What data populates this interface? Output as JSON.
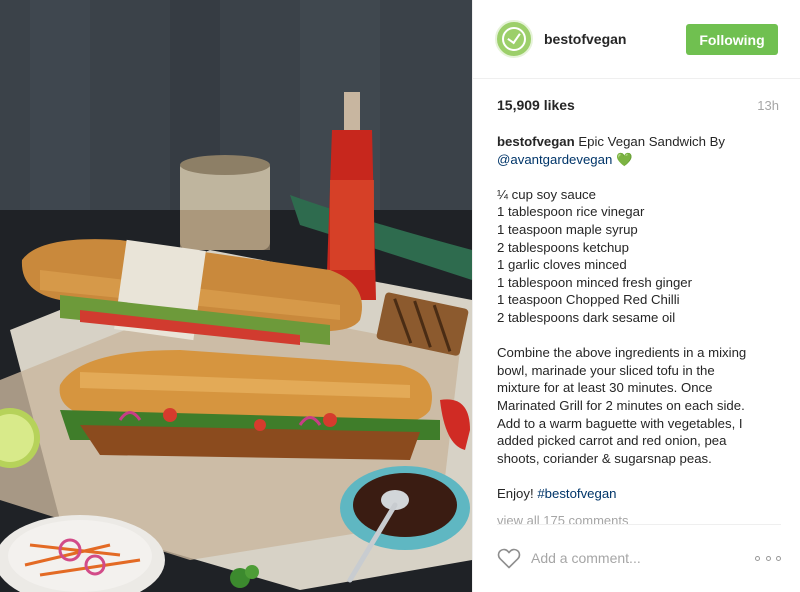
{
  "post": {
    "username": "bestofvegan",
    "follow_label": "Following",
    "likes": "15,909 likes",
    "time": "13h",
    "caption": {
      "author": "bestofvegan",
      "title": "Epic Vegan Sandwich By",
      "mention": "@avantgardevegan",
      "emoji": "💚",
      "ingredients": [
        "¼ cup soy sauce",
        "1 tablespoon rice vinegar",
        "1 teaspoon maple syrup",
        "2 tablespoons ketchup",
        "1 garlic cloves minced",
        "1 tablespoon minced fresh ginger",
        "1 teaspoon Chopped Red Chilli",
        "2 tablespoons dark sesame oil"
      ],
      "instructions": [
        "Combine the above ingredients in a mixing",
        "bowl, marinade your sliced tofu in the",
        "mixture for at least 30 minutes. Once",
        "Marinated Grill for 2 minutes on each side.",
        "Add to a warm baguette with vegetables, I",
        "added picked carrot and red onion, pea",
        "shoots, coriander & sugarsnap peas."
      ],
      "closing": "Enjoy!",
      "hashtag": "#bestofvegan"
    },
    "view_comments": "view all 175 comments",
    "comment_placeholder": "Add a comment...",
    "icons": {
      "avatar": "leaf-logo-avatar",
      "like": "heart-outline-icon",
      "more": "more-options-icon"
    },
    "colors": {
      "follow_button": "#70c050",
      "link": "#003569",
      "muted": "#a6a6a6",
      "avatar": "#9ccf6a"
    }
  }
}
